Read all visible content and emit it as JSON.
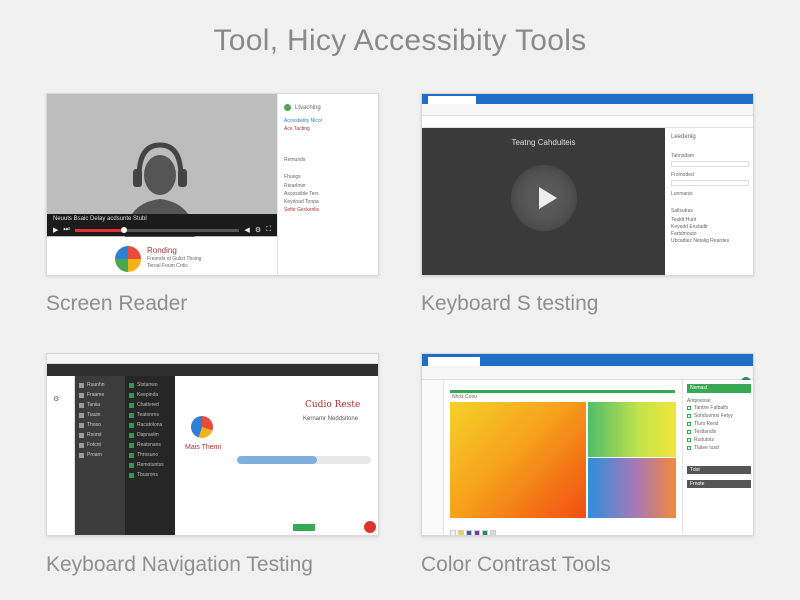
{
  "page_title": "Tool, Hicy Accessibity Tools",
  "colors": {
    "background": "#f1f1f2",
    "browser_blue": "#1f6fc6",
    "accent_green": "#38a852",
    "accent_red": "#e03030"
  },
  "cards": [
    {
      "caption": "Screen Reader",
      "video_caption": "Neuuts Bsaic Delay acdsunte Stubl",
      "brand_title": "Ronding",
      "brand_sub": "Freonds ot Gulist Tbsing",
      "brand_sub2": "Teroal Foum Crdic",
      "side_title": "Ltvaching",
      "side_lines": [
        "Accesbelity Nlcor",
        "Ace Tacting"
      ],
      "side_label": "Remunds",
      "side_section": "Fhuegs",
      "side_items": [
        "Rtearlmer",
        "Ascessible Ters",
        "Keydoad Tonpa",
        "Sefte Geckenlis"
      ]
    },
    {
      "caption": "Keyboard S testing",
      "stage_title": "Teatng Cahdulteis",
      "side_title": "Leedenig",
      "side_fields": [
        "Tahnsdam",
        "Fromoded",
        "Lunmanis"
      ],
      "side_section": "Sallsutras",
      "side_items": [
        "Tealdt Hunt",
        "Keyedd Enstadtr",
        "Fartdmouto",
        "Ubcadiez Netalig Reardes"
      ]
    },
    {
      "caption": "Keyboard Navigation Testing",
      "title_text": "Cudio Reste",
      "subtitle_text": "Kernamr Neddsitone",
      "side_name": "Mais Themi",
      "tree_items": [
        "Ruunhn",
        "Fraame",
        "Taniia",
        "Tiauin",
        "Thoso",
        "Rsorst",
        "Fotcnt",
        "Proarn"
      ],
      "list_items": [
        "Ststanwo",
        "Keepinda",
        "Chattered",
        "Teatonrns",
        "Racatolona",
        "Dapraolm",
        "Reatsnans",
        "Throsuno",
        "Remotuntss",
        "Tbusrons"
      ]
    },
    {
      "caption": "Color Contrast Tools",
      "header_text": "Nhos Coou",
      "side_header": "Nemasf",
      "side_label": "Antpoesse",
      "side_items": [
        "Tantne Fatbalfs",
        "Sohduonos Fetyy",
        "Tlurs Rend",
        "Testlandls",
        "Rudutnts",
        "Tlatee Iusd"
      ],
      "side_buttons": [
        "Tdst",
        "Frnote"
      ],
      "palette": [
        "#f2f2f2",
        "#f2d244",
        "#3a62b8",
        "#7a3aa0",
        "#1f8d6a",
        "#d8d8d8"
      ]
    }
  ]
}
